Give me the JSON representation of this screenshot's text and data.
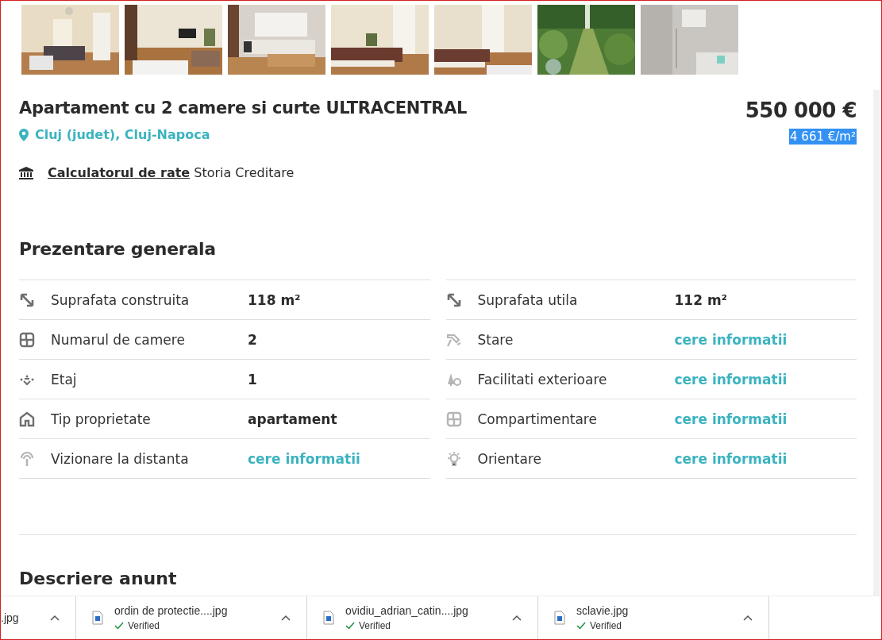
{
  "listing": {
    "title": "Apartament cu 2 camere si curte ULTRACENTRAL",
    "location": "Cluj (judet), Cluj-Napoca",
    "price": "550 000 €",
    "price_per_sqm": {
      "text": "4 661 €/m²",
      "selected": true
    }
  },
  "credit": {
    "link": "Calculatorul de rate",
    "provider": "Storia Creditare"
  },
  "overview": {
    "title": "Prezentare generala",
    "columns": [
      [
        {
          "kind": "area",
          "label": "Suprafata construita",
          "value": "118 m²",
          "request": false
        },
        {
          "kind": "rooms",
          "label": "Numarul de camere",
          "value": "2",
          "request": false
        },
        {
          "kind": "floor",
          "label": "Etaj",
          "value": "1",
          "request": false
        },
        {
          "kind": "house",
          "label": "Tip proprietate",
          "value": "apartament",
          "request": false
        },
        {
          "kind": "remote",
          "label": "Vizionare la distanta",
          "value": "cere informatii",
          "request": true
        }
      ],
      [
        {
          "kind": "area",
          "label": "Suprafata utila",
          "value": "112 m²",
          "request": false
        },
        {
          "kind": "tool",
          "label": "Stare",
          "value": "cere informatii",
          "request": true
        },
        {
          "kind": "outdoor",
          "label": "Facilitati exterioare",
          "value": "cere informatii",
          "request": true
        },
        {
          "kind": "rooms",
          "label": "Compartimentare",
          "value": "cere informatii",
          "request": true
        },
        {
          "kind": "light",
          "label": "Orientare",
          "value": "cere informatii",
          "request": true
        }
      ]
    ]
  },
  "description": {
    "title": "Descriere anunt"
  },
  "downloads": [
    {
      "name": ".jpg",
      "verified": false
    },
    {
      "name": "ordin de protectie....jpg",
      "verified": true,
      "status": "Verified"
    },
    {
      "name": "ovidiu_adrian_catin....jpg",
      "verified": true,
      "status": "Verified"
    },
    {
      "name": "sclavie.jpg",
      "verified": true,
      "status": "Verified"
    }
  ]
}
